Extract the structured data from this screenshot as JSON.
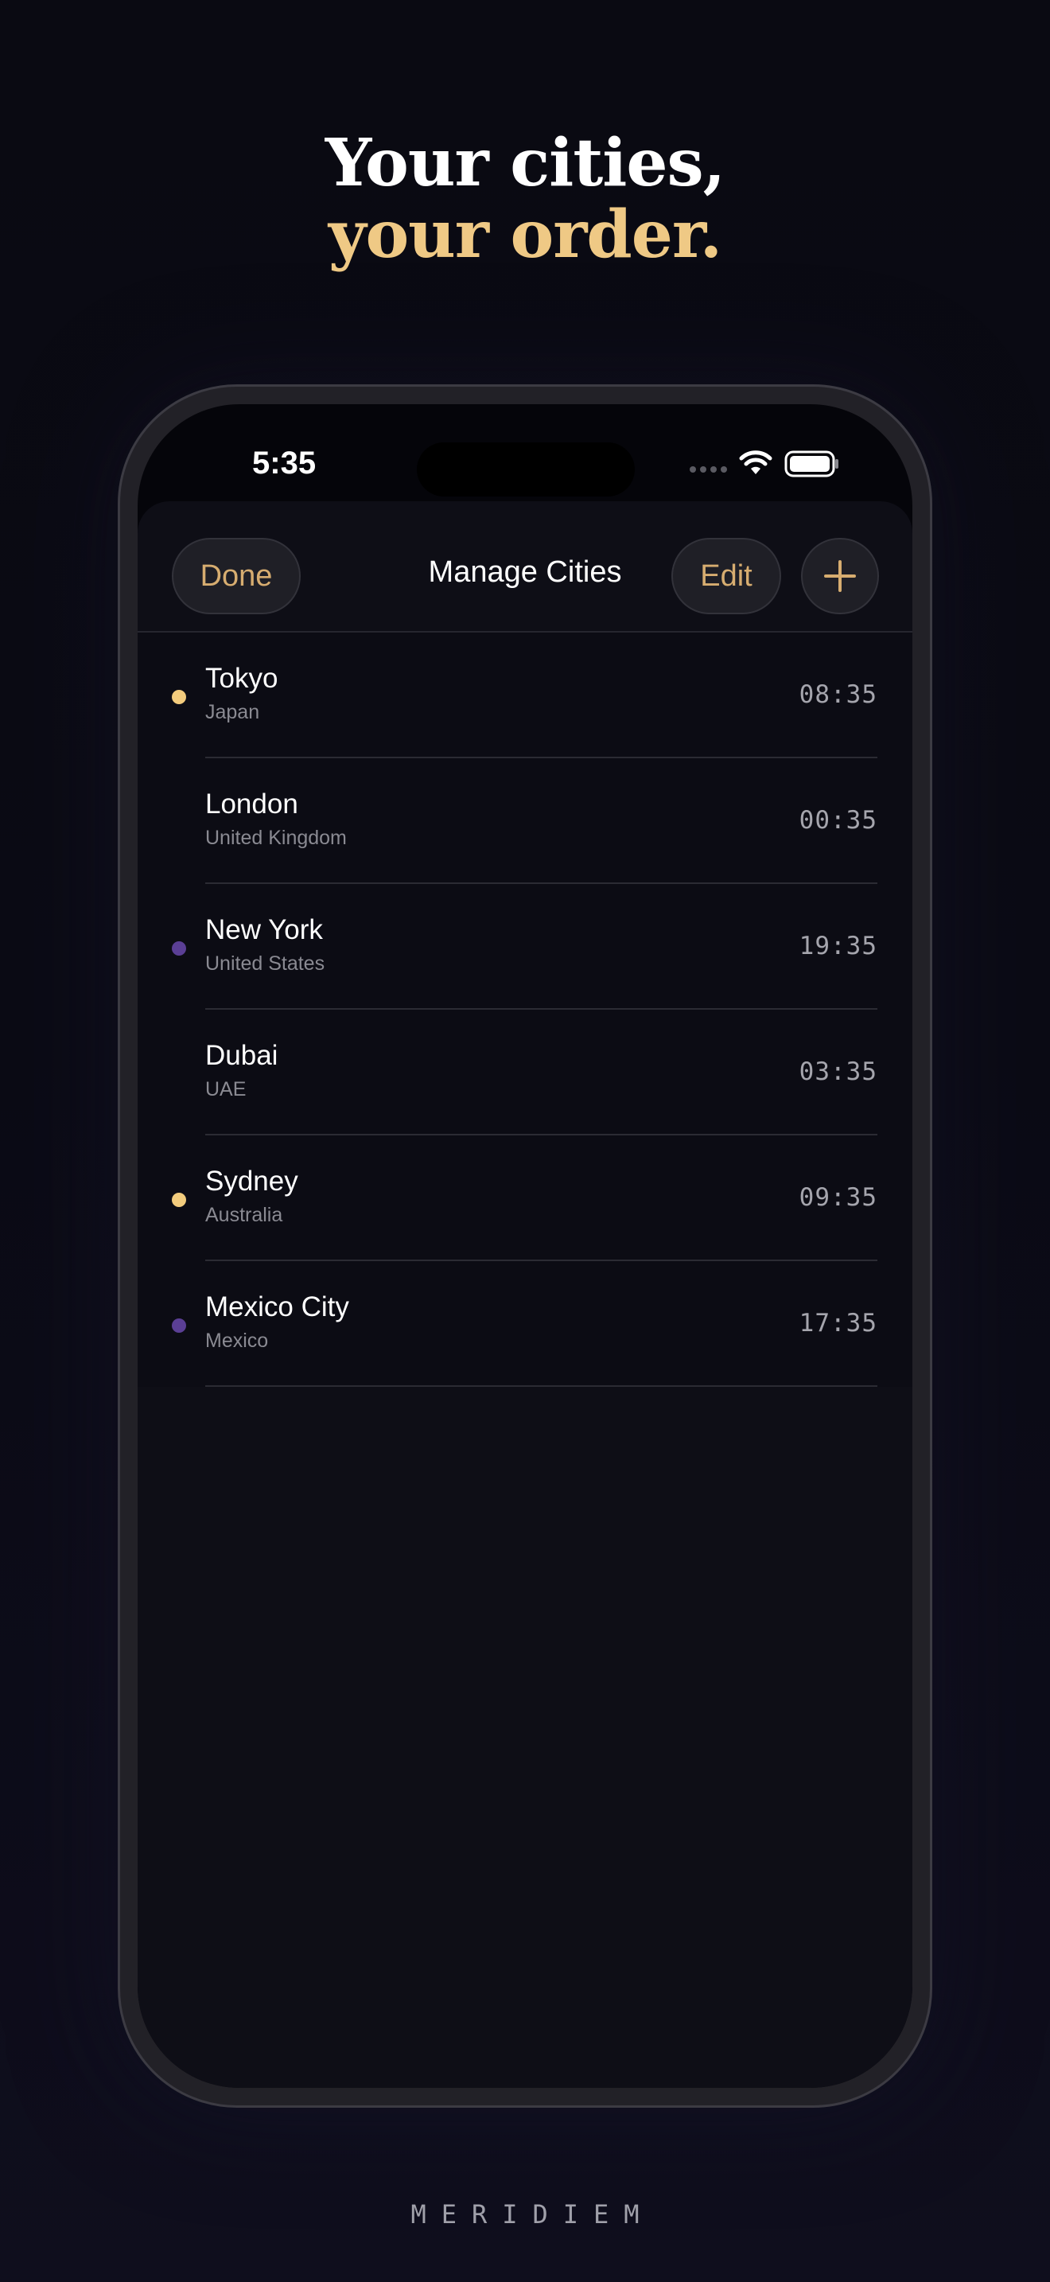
{
  "headline": {
    "line1": "Your cities,",
    "line2": "your order."
  },
  "status_bar": {
    "time": "5:35",
    "icons": [
      "signal-icon",
      "wifi-icon",
      "battery-icon"
    ]
  },
  "nav": {
    "done_label": "Done",
    "title": "Manage Cities",
    "edit_label": "Edit",
    "add_icon": "plus-icon"
  },
  "cities": [
    {
      "city": "Tokyo",
      "country": "Japan",
      "time": "08:35",
      "dot": "#f3cc7d"
    },
    {
      "city": "London",
      "country": "United Kingdom",
      "time": "00:35",
      "dot": null
    },
    {
      "city": "New York",
      "country": "United States",
      "time": "19:35",
      "dot": "#5b3f95"
    },
    {
      "city": "Dubai",
      "country": "UAE",
      "time": "03:35",
      "dot": null
    },
    {
      "city": "Sydney",
      "country": "Australia",
      "time": "09:35",
      "dot": "#f3cc7d"
    },
    {
      "city": "Mexico City",
      "country": "Mexico",
      "time": "17:35",
      "dot": "#5b3f95"
    }
  ],
  "colors": {
    "accent_gold": "#efc985",
    "day_dot": "#f3cc7d",
    "night_dot": "#5b3f95",
    "background": "#0a0a12"
  },
  "brand": "MERIDIEM"
}
